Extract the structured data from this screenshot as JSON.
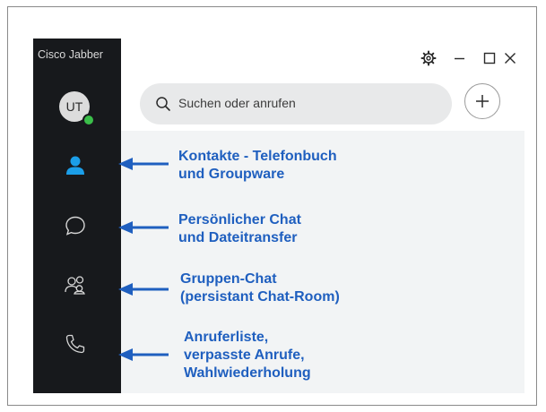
{
  "app": {
    "title": "Cisco Jabber",
    "avatar_initials": "UT",
    "presence_color": "#3bbf4a",
    "accent_color": "#1b9ee8"
  },
  "sidebar": {
    "items": [
      {
        "id": "contacts",
        "icon": "person-icon",
        "active": true
      },
      {
        "id": "chat",
        "icon": "chat-bubble-icon",
        "active": false
      },
      {
        "id": "group-chat",
        "icon": "group-icon",
        "active": false
      },
      {
        "id": "calls",
        "icon": "phone-icon",
        "active": false
      }
    ]
  },
  "window_controls": {
    "icons": [
      "gear-icon",
      "minimize-icon",
      "maximize-icon",
      "close-icon"
    ]
  },
  "search": {
    "placeholder": "Suchen oder anrufen",
    "icon": "search-icon"
  },
  "add_button": {
    "icon": "plus-icon"
  },
  "annotations": [
    {
      "line1": "Kontakte - Telefonbuch",
      "line2": "und Groupware"
    },
    {
      "line1": "Persönlicher Chat",
      "line2": "und Dateitransfer"
    },
    {
      "line1": "Gruppen-Chat",
      "line2": "(persistant Chat-Room)"
    },
    {
      "line1": "Anruferliste,",
      "line2": "verpasste Anrufe,",
      "line3": "Wahlwiederholung"
    }
  ],
  "annotation_color": "#1f5fbf"
}
